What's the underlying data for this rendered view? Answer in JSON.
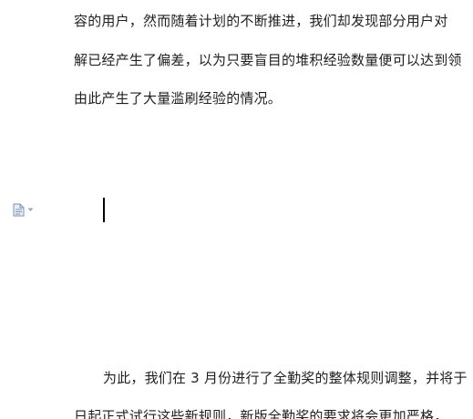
{
  "document": {
    "lines": [
      "容的用户，然而随着计划的不断推进，我们却发现部分用户对",
      "解已经产生了偏差，以为只要盲目的堆积经验数量便可以达到领",
      "由此产生了大量滥刷经验的情况。",
      "为此，我们在 3 月份进行了全勤奖的整体规则调整，并将于",
      "日起正式试行这些新规则，新版全勤奖的要求将会更加严格，"
    ]
  },
  "gutter": {
    "paragraph_icon": "document-icon",
    "dropdown_icon": "chevron-down-icon"
  },
  "colors": {
    "text": "#1f1f1f",
    "gutter_icon": "#7a93b8",
    "background": "#ffffff"
  }
}
